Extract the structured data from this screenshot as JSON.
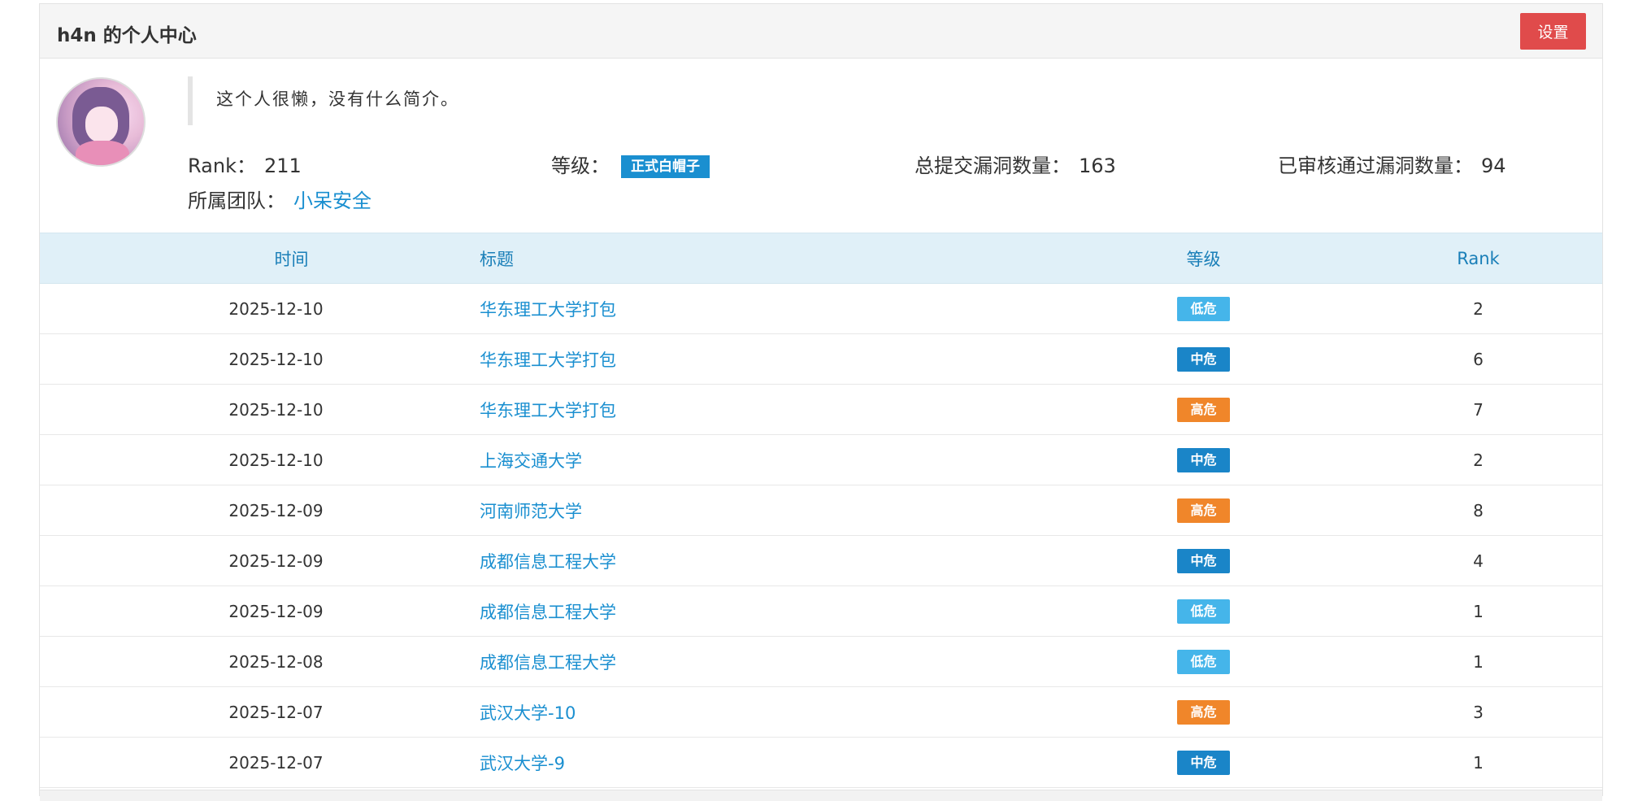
{
  "header": {
    "title": "h4n 的个人中心",
    "settings_label": "设置"
  },
  "profile": {
    "avatar_alt": "user-avatar",
    "bio": "这个人很懒，没有什么简介。",
    "rank_label": "Rank：",
    "rank_value": "211",
    "level_label": "等级：",
    "level_value": "正式白帽子",
    "submitted_label": "总提交漏洞数量：",
    "submitted_value": "163",
    "approved_label": "已审核通过漏洞数量：",
    "approved_value": "94",
    "team_label": "所属团队：",
    "team_value": "小呆安全"
  },
  "table": {
    "columns": [
      "时间",
      "标题",
      "等级",
      "Rank"
    ],
    "rows": [
      {
        "date": "2025-12-10",
        "title": "华东理工大学打包",
        "level": "低危",
        "rank": "2"
      },
      {
        "date": "2025-12-10",
        "title": "华东理工大学打包",
        "level": "中危",
        "rank": "6"
      },
      {
        "date": "2025-12-10",
        "title": "华东理工大学打包",
        "level": "高危",
        "rank": "7"
      },
      {
        "date": "2025-12-10",
        "title": "上海交通大学",
        "level": "中危",
        "rank": "2"
      },
      {
        "date": "2025-12-09",
        "title": "河南师范大学",
        "level": "高危",
        "rank": "8"
      },
      {
        "date": "2025-12-09",
        "title": "成都信息工程大学",
        "level": "中危",
        "rank": "4"
      },
      {
        "date": "2025-12-09",
        "title": "成都信息工程大学",
        "level": "低危",
        "rank": "1"
      },
      {
        "date": "2025-12-08",
        "title": "成都信息工程大学",
        "level": "低危",
        "rank": "1"
      },
      {
        "date": "2025-12-07",
        "title": "武汉大学-10",
        "level": "高危",
        "rank": "3"
      },
      {
        "date": "2025-12-07",
        "title": "武汉大学-9",
        "level": "中危",
        "rank": "1"
      }
    ]
  },
  "severity_colors": {
    "低危": "#45b5ea",
    "中危": "#1a85c8",
    "高危": "#f0862a"
  }
}
